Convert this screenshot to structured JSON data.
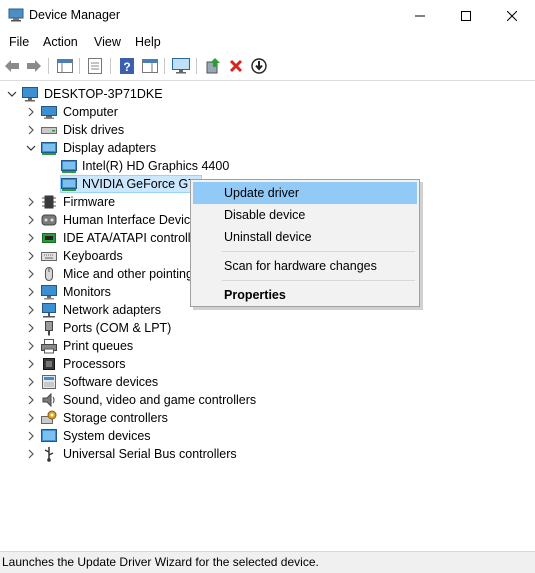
{
  "window": {
    "title": "Device Manager"
  },
  "menu": [
    "File",
    "Action",
    "View",
    "Help"
  ],
  "tree": {
    "root": "DESKTOP-3P71DKE",
    "categories": [
      {
        "label": "Computer",
        "icon": "computer-icon",
        "expanded": false
      },
      {
        "label": "Disk drives",
        "icon": "disk-drive-icon",
        "expanded": false
      },
      {
        "label": "Display adapters",
        "icon": "display-adapter-icon",
        "expanded": true,
        "children": [
          {
            "label": "Intel(R) HD Graphics 4400",
            "icon": "display-adapter-icon"
          },
          {
            "label": "NVIDIA GeForce GTX",
            "icon": "display-adapter-icon",
            "selected": true
          }
        ]
      },
      {
        "label": "Firmware",
        "icon": "firmware-icon",
        "expanded": false
      },
      {
        "label": "Human Interface Device",
        "icon": "hid-icon",
        "expanded": false
      },
      {
        "label": "IDE ATA/ATAPI controlle",
        "icon": "ide-controller-icon",
        "expanded": false
      },
      {
        "label": "Keyboards",
        "icon": "keyboard-icon",
        "expanded": false
      },
      {
        "label": "Mice and other pointing",
        "icon": "mouse-icon",
        "expanded": false
      },
      {
        "label": "Monitors",
        "icon": "monitor-icon",
        "expanded": false
      },
      {
        "label": "Network adapters",
        "icon": "network-adapter-icon",
        "expanded": false
      },
      {
        "label": "Ports (COM & LPT)",
        "icon": "port-icon",
        "expanded": false
      },
      {
        "label": "Print queues",
        "icon": "printer-icon",
        "expanded": false
      },
      {
        "label": "Processors",
        "icon": "processor-icon",
        "expanded": false
      },
      {
        "label": "Software devices",
        "icon": "software-device-icon",
        "expanded": false
      },
      {
        "label": "Sound, video and game controllers",
        "icon": "sound-icon",
        "expanded": false
      },
      {
        "label": "Storage controllers",
        "icon": "storage-controller-icon",
        "expanded": false
      },
      {
        "label": "System devices",
        "icon": "system-device-icon",
        "expanded": false
      },
      {
        "label": "Universal Serial Bus controllers",
        "icon": "usb-icon",
        "expanded": false
      }
    ]
  },
  "context_menu": {
    "update_driver": "Update driver",
    "disable_device": "Disable device",
    "uninstall_device": "Uninstall device",
    "scan_hardware": "Scan for hardware changes",
    "properties": "Properties"
  },
  "status": "Launches the Update Driver Wizard for the selected device.",
  "colors": {
    "selection": "#cce8ff",
    "menu_highlight": "#91c9f7",
    "uninstall_red": "#d9241c",
    "update_green": "#2e9b3a"
  }
}
